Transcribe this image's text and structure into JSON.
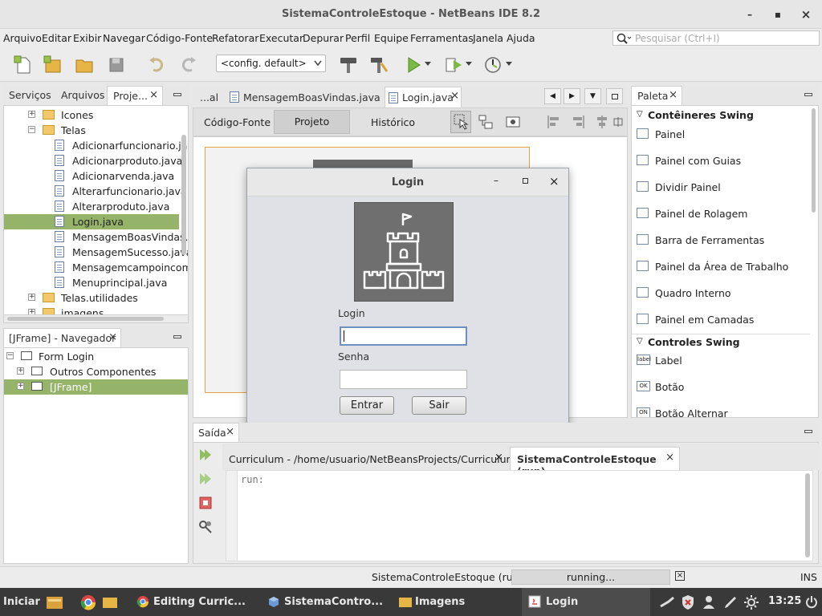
{
  "window": {
    "title": "SistemaControleEstoque - NetBeans IDE 8.2",
    "minimize": "–",
    "maximize": "▪",
    "close": "×"
  },
  "menu": [
    "Arquivo",
    "Editar",
    "Exibir",
    "Navegar",
    "Código-Fonte",
    "Refatorar",
    "Executar",
    "Depurar",
    "Perfil",
    "Equipe",
    "Ferramentas",
    "Janela",
    "Ajuda"
  ],
  "search": {
    "placeholder": "Pesquisar (Ctrl+I)"
  },
  "toolbar": {
    "config": "<config. default>"
  },
  "project_panel": {
    "tabs": [
      "Serviços",
      "Arquivos",
      "Proje..."
    ],
    "tree": [
      {
        "label": "Icones",
        "type": "folder",
        "level": 1,
        "expander": "+"
      },
      {
        "label": "Telas",
        "type": "folder",
        "level": 1,
        "expander": "−"
      },
      {
        "label": "Adicionarfuncionario.java",
        "type": "file",
        "level": 2
      },
      {
        "label": "Adicionarproduto.java",
        "type": "file",
        "level": 2
      },
      {
        "label": "Adicionarvenda.java",
        "type": "file",
        "level": 2
      },
      {
        "label": "Alterarfuncionario.java",
        "type": "file",
        "level": 2
      },
      {
        "label": "Alterarproduto.java",
        "type": "file",
        "level": 2
      },
      {
        "label": "Login.java",
        "type": "file",
        "level": 2,
        "selected": true
      },
      {
        "label": "MensagemBoasVindas.java",
        "type": "file",
        "level": 2
      },
      {
        "label": "MensagemSucesso.java",
        "type": "file",
        "level": 2
      },
      {
        "label": "Mensagemcampoincompleto.java",
        "type": "file",
        "level": 2
      },
      {
        "label": "Menuprincipal.java",
        "type": "file",
        "level": 2
      },
      {
        "label": "Telas.utilidades",
        "type": "folder",
        "level": 1,
        "expander": "+"
      },
      {
        "label": "imagens",
        "type": "folder",
        "level": 1,
        "expander": "+"
      }
    ]
  },
  "navigator": {
    "title": "[JFrame] - Navegador",
    "tree": [
      {
        "label": "Form Login",
        "level": 0,
        "expander": "−"
      },
      {
        "label": "Outros Componentes",
        "level": 1,
        "expander": "+"
      },
      {
        "label": "[JFrame]",
        "level": 1,
        "expander": "+",
        "selected": true
      }
    ]
  },
  "editor": {
    "tabs": [
      "...al",
      "MensagemBoasVindas.java",
      "Login.java"
    ],
    "view_tabs": [
      "Código-Fonte",
      "Projeto",
      "Histórico"
    ]
  },
  "dialog": {
    "title": "Login",
    "login_label": "Login",
    "senha_label": "Senha",
    "enter_button": "Entrar",
    "exit_button": "Sair"
  },
  "palette": {
    "title": "Paleta",
    "sections": [
      {
        "title": "Contêineres Swing",
        "items": [
          "Painel",
          "Painel com Guias",
          "Dividir Painel",
          "Painel de Rolagem",
          "Barra de Ferramentas",
          "Painel da Área de Trabalho",
          "Quadro Interno",
          "Painel em Camadas"
        ]
      },
      {
        "title": "Controles Swing",
        "items": [
          "Label",
          "Botão",
          "Botão Alternar"
        ]
      }
    ],
    "icon_labels": [
      "label",
      "OK",
      "ON"
    ]
  },
  "output": {
    "title": "Saída",
    "tabs": [
      "Curriculum - /home/usuario/NetBeansProjects/Curriculum",
      "SistemaControleEstoque (run)"
    ],
    "text": "run:"
  },
  "status": {
    "task": "SistemaControleEstoque (run)",
    "progress_text": "running...",
    "mode": "INS"
  },
  "taskbar": {
    "start": "Iniciar",
    "items": [
      "Editing Curric...",
      "SistemaContro...",
      "Imagens",
      "Login"
    ],
    "clock": "13:25"
  },
  "colors": {
    "selection": "#95b46a",
    "accent_orange": "#e8a349"
  }
}
